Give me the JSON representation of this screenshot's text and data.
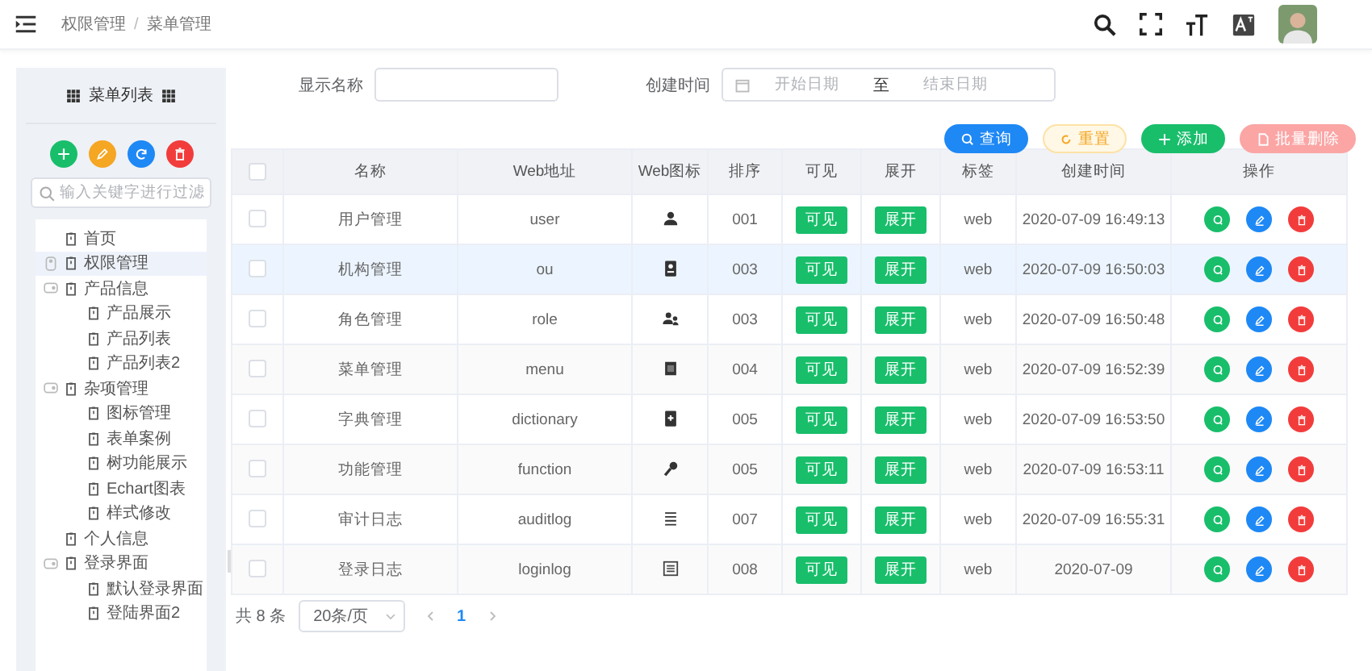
{
  "header": {
    "breadcrumb": [
      "权限管理",
      "菜单管理"
    ],
    "separator": "/"
  },
  "sidebar": {
    "title": "菜单列表",
    "search": {
      "placeholder": "输入关键字进行过滤"
    },
    "tree": [
      {
        "label": "首页",
        "selected": false
      },
      {
        "label": "权限管理",
        "selected": true,
        "expanded": false
      },
      {
        "label": "产品信息",
        "selected": false,
        "expanded": true,
        "children": [
          {
            "label": "产品展示",
            "selected": false
          },
          {
            "label": "产品列表",
            "selected": false
          },
          {
            "label": "产品列表2",
            "selected": false
          }
        ]
      },
      {
        "label": "杂项管理",
        "selected": false,
        "expanded": true,
        "children": [
          {
            "label": "图标管理",
            "selected": false
          },
          {
            "label": "表单案例",
            "selected": false
          },
          {
            "label": "树功能展示",
            "selected": false
          },
          {
            "label": "Echart图表",
            "selected": false
          },
          {
            "label": "样式修改",
            "selected": false
          }
        ]
      },
      {
        "label": "个人信息",
        "selected": false
      },
      {
        "label": "登录界面",
        "selected": false,
        "expanded": true,
        "children": [
          {
            "label": "默认登录界面",
            "selected": false
          },
          {
            "label": "登陆界面2",
            "selected": false
          }
        ]
      }
    ]
  },
  "filters": {
    "name_label": "显示名称",
    "date_label": "创建时间",
    "start_placeholder": "开始日期",
    "range_separator": "至",
    "end_placeholder": "结束日期"
  },
  "actions": [
    {
      "kind": "search",
      "label": "查询"
    },
    {
      "kind": "reset",
      "label": "重置"
    },
    {
      "kind": "add",
      "label": "添加"
    },
    {
      "kind": "delete",
      "label": "批量删除"
    }
  ],
  "table": {
    "all_checked": false,
    "columns": [
      "名称",
      "Web地址",
      "Web图标",
      "排序",
      "可见",
      "展开",
      "标签",
      "创建时间",
      "操作"
    ],
    "rows": [
      {
        "name": "用户管理",
        "url": "user",
        "order": "001",
        "visible": "可见",
        "expand": "展开",
        "tag": "web",
        "created": "2020-07-09 16:49:13",
        "selected": false,
        "checked": false
      },
      {
        "name": "机构管理",
        "url": "ou",
        "order": "003",
        "visible": "可见",
        "expand": "展开",
        "tag": "web",
        "created": "2020-07-09 16:50:03",
        "selected": true,
        "checked": false
      },
      {
        "name": "角色管理",
        "url": "role",
        "order": "003",
        "visible": "可见",
        "expand": "展开",
        "tag": "web",
        "created": "2020-07-09 16:50:48",
        "selected": false,
        "checked": false
      },
      {
        "name": "菜单管理",
        "url": "menu",
        "order": "004",
        "visible": "可见",
        "expand": "展开",
        "tag": "web",
        "created": "2020-07-09 16:52:39",
        "selected": false,
        "checked": false
      },
      {
        "name": "字典管理",
        "url": "dictionary",
        "order": "005",
        "visible": "可见",
        "expand": "展开",
        "tag": "web",
        "created": "2020-07-09 16:53:50",
        "selected": false,
        "checked": false
      },
      {
        "name": "功能管理",
        "url": "function",
        "order": "005",
        "visible": "可见",
        "expand": "展开",
        "tag": "web",
        "created": "2020-07-09 16:53:11",
        "selected": false,
        "checked": false
      },
      {
        "name": "审计日志",
        "url": "auditlog",
        "order": "007",
        "visible": "可见",
        "expand": "展开",
        "tag": "web",
        "created": "2020-07-09 16:55:31",
        "selected": false,
        "checked": false
      },
      {
        "name": "登录日志",
        "url": "loginlog",
        "order": "008",
        "visible": "可见",
        "expand": "展开",
        "tag": "web",
        "created": "2020-07-09",
        "selected": false,
        "checked": false
      }
    ]
  },
  "pagination": {
    "total": "共 8 条",
    "page_size": "20条/页",
    "pages": [
      {
        "label": "1",
        "selected": true
      }
    ]
  }
}
